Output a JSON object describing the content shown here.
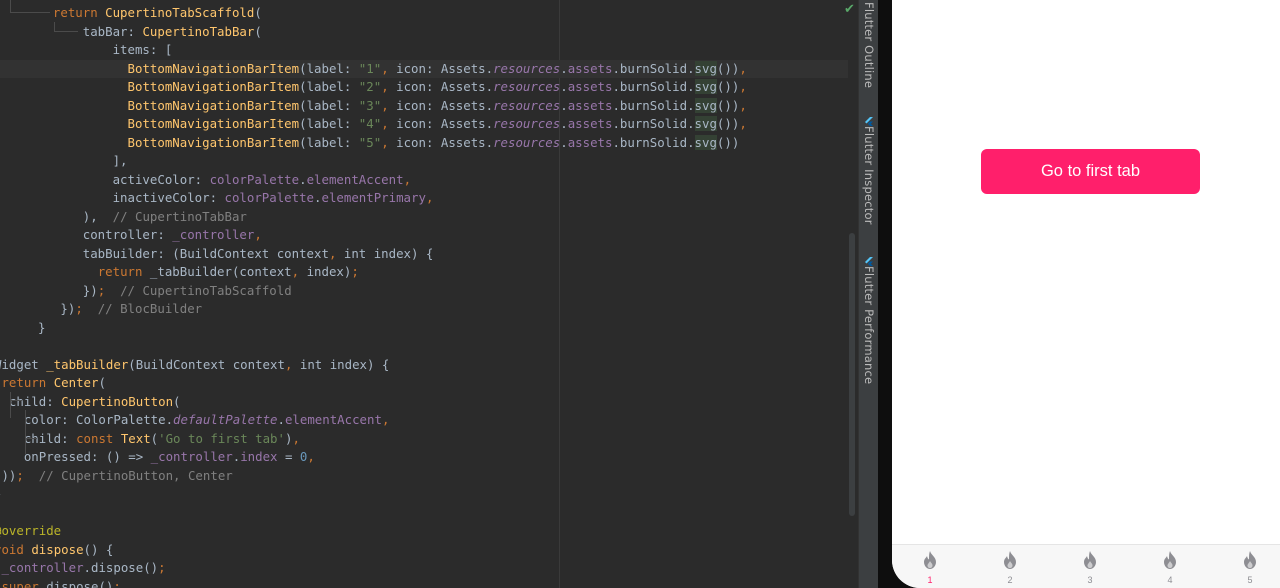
{
  "editor": {
    "lines": [
      [
        [
          "  ",
          "plain"
        ],
        [
          "return ",
          "kw"
        ],
        [
          "CupertinoTabScaffold",
          "cls"
        ],
        [
          "(",
          "plain"
        ]
      ],
      [
        [
          "      tabBar: ",
          "plain"
        ],
        [
          "CupertinoTabBar",
          "cls"
        ],
        [
          "(",
          "plain"
        ]
      ],
      [
        [
          "          items: [",
          "plain"
        ]
      ],
      [
        [
          "            ",
          "plain"
        ],
        [
          "BottomNavigationBarItem",
          "cls"
        ],
        [
          "(label: ",
          "plain"
        ],
        [
          "\"1\"",
          "str"
        ],
        [
          ", ",
          "kw"
        ],
        [
          "icon: Assets.",
          "plain"
        ],
        [
          "resources",
          "fld it"
        ],
        [
          ".",
          "plain"
        ],
        [
          "assets",
          "fld"
        ],
        [
          ".burnSolid.",
          "plain"
        ],
        [
          "svg",
          "hl"
        ],
        [
          "())",
          "plain"
        ],
        [
          ",",
          "kw"
        ]
      ],
      [
        [
          "            ",
          "plain"
        ],
        [
          "BottomNavigationBarItem",
          "cls"
        ],
        [
          "(label: ",
          "plain"
        ],
        [
          "\"2\"",
          "str"
        ],
        [
          ", ",
          "kw"
        ],
        [
          "icon: Assets.",
          "plain"
        ],
        [
          "resources",
          "fld it"
        ],
        [
          ".",
          "plain"
        ],
        [
          "assets",
          "fld"
        ],
        [
          ".burnSolid.",
          "plain"
        ],
        [
          "svg",
          "hl"
        ],
        [
          "())",
          "plain"
        ],
        [
          ",",
          "kw"
        ]
      ],
      [
        [
          "            ",
          "plain"
        ],
        [
          "BottomNavigationBarItem",
          "cls"
        ],
        [
          "(label: ",
          "plain"
        ],
        [
          "\"3\"",
          "str"
        ],
        [
          ", ",
          "kw"
        ],
        [
          "icon: Assets.",
          "plain"
        ],
        [
          "resources",
          "fld it"
        ],
        [
          ".",
          "plain"
        ],
        [
          "assets",
          "fld"
        ],
        [
          ".burnSolid.",
          "plain"
        ],
        [
          "svg",
          "hl"
        ],
        [
          "())",
          "plain"
        ],
        [
          ",",
          "kw"
        ]
      ],
      [
        [
          "            ",
          "plain"
        ],
        [
          "BottomNavigationBarItem",
          "cls"
        ],
        [
          "(label: ",
          "plain"
        ],
        [
          "\"4\"",
          "str"
        ],
        [
          ", ",
          "kw"
        ],
        [
          "icon: Assets.",
          "plain"
        ],
        [
          "resources",
          "fld it"
        ],
        [
          ".",
          "plain"
        ],
        [
          "assets",
          "fld"
        ],
        [
          ".burnSolid.",
          "plain"
        ],
        [
          "svg",
          "hl"
        ],
        [
          "())",
          "plain"
        ],
        [
          ",",
          "kw"
        ]
      ],
      [
        [
          "            ",
          "plain"
        ],
        [
          "BottomNavigationBarItem",
          "cls"
        ],
        [
          "(label: ",
          "plain"
        ],
        [
          "\"5\"",
          "str"
        ],
        [
          ", ",
          "kw"
        ],
        [
          "icon: Assets.",
          "plain"
        ],
        [
          "resources",
          "fld it"
        ],
        [
          ".",
          "plain"
        ],
        [
          "assets",
          "fld"
        ],
        [
          ".burnSolid.",
          "plain"
        ],
        [
          "svg",
          "hl"
        ],
        [
          "())",
          "plain"
        ]
      ],
      [
        [
          "          ],",
          "plain"
        ]
      ],
      [
        [
          "          activeColor: ",
          "plain"
        ],
        [
          "colorPalette",
          "fld"
        ],
        [
          ".",
          "plain"
        ],
        [
          "elementAccent",
          "fld"
        ],
        [
          ",",
          "kw"
        ]
      ],
      [
        [
          "          inactiveColor: ",
          "plain"
        ],
        [
          "colorPalette",
          "fld"
        ],
        [
          ".",
          "plain"
        ],
        [
          "elementPrimary",
          "fld"
        ],
        [
          ",",
          "kw"
        ]
      ],
      [
        [
          "      ),  ",
          "plain"
        ],
        [
          "// CupertinoTabBar",
          "cmt"
        ]
      ],
      [
        [
          "      controller: ",
          "plain"
        ],
        [
          "_controller",
          "fld"
        ],
        [
          ",",
          "kw"
        ]
      ],
      [
        [
          "      tabBuilder: (BuildContext context",
          "plain"
        ],
        [
          ", ",
          "kw"
        ],
        [
          "int ",
          "plain"
        ],
        [
          "index) {",
          "plain"
        ]
      ],
      [
        [
          "        ",
          "plain"
        ],
        [
          "return ",
          "kw"
        ],
        [
          "_tabBuilder(context",
          "plain"
        ],
        [
          ", ",
          "kw"
        ],
        [
          "index)",
          "plain"
        ],
        [
          ";",
          "kw"
        ]
      ],
      [
        [
          "      })",
          "plain"
        ],
        [
          ";  ",
          "kw"
        ],
        [
          "// CupertinoTabScaffold",
          "cmt"
        ]
      ],
      [
        [
          "   })",
          "plain"
        ],
        [
          ";  ",
          "kw"
        ],
        [
          "// BlocBuilder",
          "cmt"
        ]
      ],
      [
        [
          "}",
          "plain"
        ]
      ],
      [
        [
          "",
          "plain"
        ]
      ],
      [
        [
          "Widget ",
          "plain"
        ],
        [
          "_tabBuilder",
          "cls"
        ],
        [
          "(BuildContext context",
          "plain"
        ],
        [
          ", ",
          "kw"
        ],
        [
          "int ",
          "plain"
        ],
        [
          "index) {",
          "plain"
        ]
      ],
      [
        [
          " ",
          "plain"
        ],
        [
          "return ",
          "kw"
        ],
        [
          "Center",
          "cls"
        ],
        [
          "(",
          "plain"
        ]
      ],
      [
        [
          "  child: ",
          "plain"
        ],
        [
          "CupertinoButton",
          "cls"
        ],
        [
          "(",
          "plain"
        ]
      ],
      [
        [
          "    color: ColorPalette.",
          "plain"
        ],
        [
          "defaultPalette",
          "fld it"
        ],
        [
          ".",
          "plain"
        ],
        [
          "elementAccent",
          "fld"
        ],
        [
          ",",
          "kw"
        ]
      ],
      [
        [
          "    child: ",
          "plain"
        ],
        [
          "const ",
          "kw"
        ],
        [
          "Text",
          "cls"
        ],
        [
          "(",
          "plain"
        ],
        [
          "'Go to first tab'",
          "str"
        ],
        [
          ")",
          "plain"
        ],
        [
          ",",
          "kw"
        ]
      ],
      [
        [
          "    onPressed: () => ",
          "plain"
        ],
        [
          "_controller",
          "fld"
        ],
        [
          ".",
          "plain"
        ],
        [
          "index",
          "fld"
        ],
        [
          " = ",
          "plain"
        ],
        [
          "0",
          "num"
        ],
        [
          ",",
          "kw"
        ]
      ],
      [
        [
          " ))",
          "plain"
        ],
        [
          ";  ",
          "kw"
        ],
        [
          "// CupertinoButton, Center",
          "cmt"
        ]
      ],
      [
        [
          "}",
          "plain"
        ]
      ],
      [
        [
          "",
          "plain"
        ]
      ],
      [
        [
          "@override",
          "ann"
        ]
      ],
      [
        [
          "void ",
          "kw"
        ],
        [
          "dispose",
          "cls"
        ],
        [
          "() {",
          "plain"
        ]
      ],
      [
        [
          " ",
          "plain"
        ],
        [
          "_controller",
          "fld"
        ],
        [
          ".dispose()",
          "plain"
        ],
        [
          ";",
          "kw"
        ]
      ],
      [
        [
          " ",
          "plain"
        ],
        [
          "super",
          "kw"
        ],
        [
          ".dispose()",
          "plain"
        ],
        [
          ";",
          "kw"
        ]
      ]
    ],
    "current_line": 3
  },
  "tool_windows": [
    {
      "label": "Flutter Outline",
      "icon": "outline-icon"
    },
    {
      "label": "Flutter Inspector",
      "icon": "flutter-icon"
    },
    {
      "label": "Flutter Performance",
      "icon": "flutter-icon"
    }
  ],
  "app": {
    "button_label": "Go to first tab",
    "accent": "#ff1f6b",
    "tabs": [
      {
        "label": "1",
        "active": true
      },
      {
        "label": "2",
        "active": false
      },
      {
        "label": "3",
        "active": false
      },
      {
        "label": "4",
        "active": false
      },
      {
        "label": "5",
        "active": false
      }
    ]
  },
  "colors": {
    "editor_bg": "#2b2b2b",
    "keyword": "#cc7832",
    "class": "#ffc66d",
    "string": "#6a8759",
    "field": "#9876aa",
    "comment": "#808080"
  }
}
